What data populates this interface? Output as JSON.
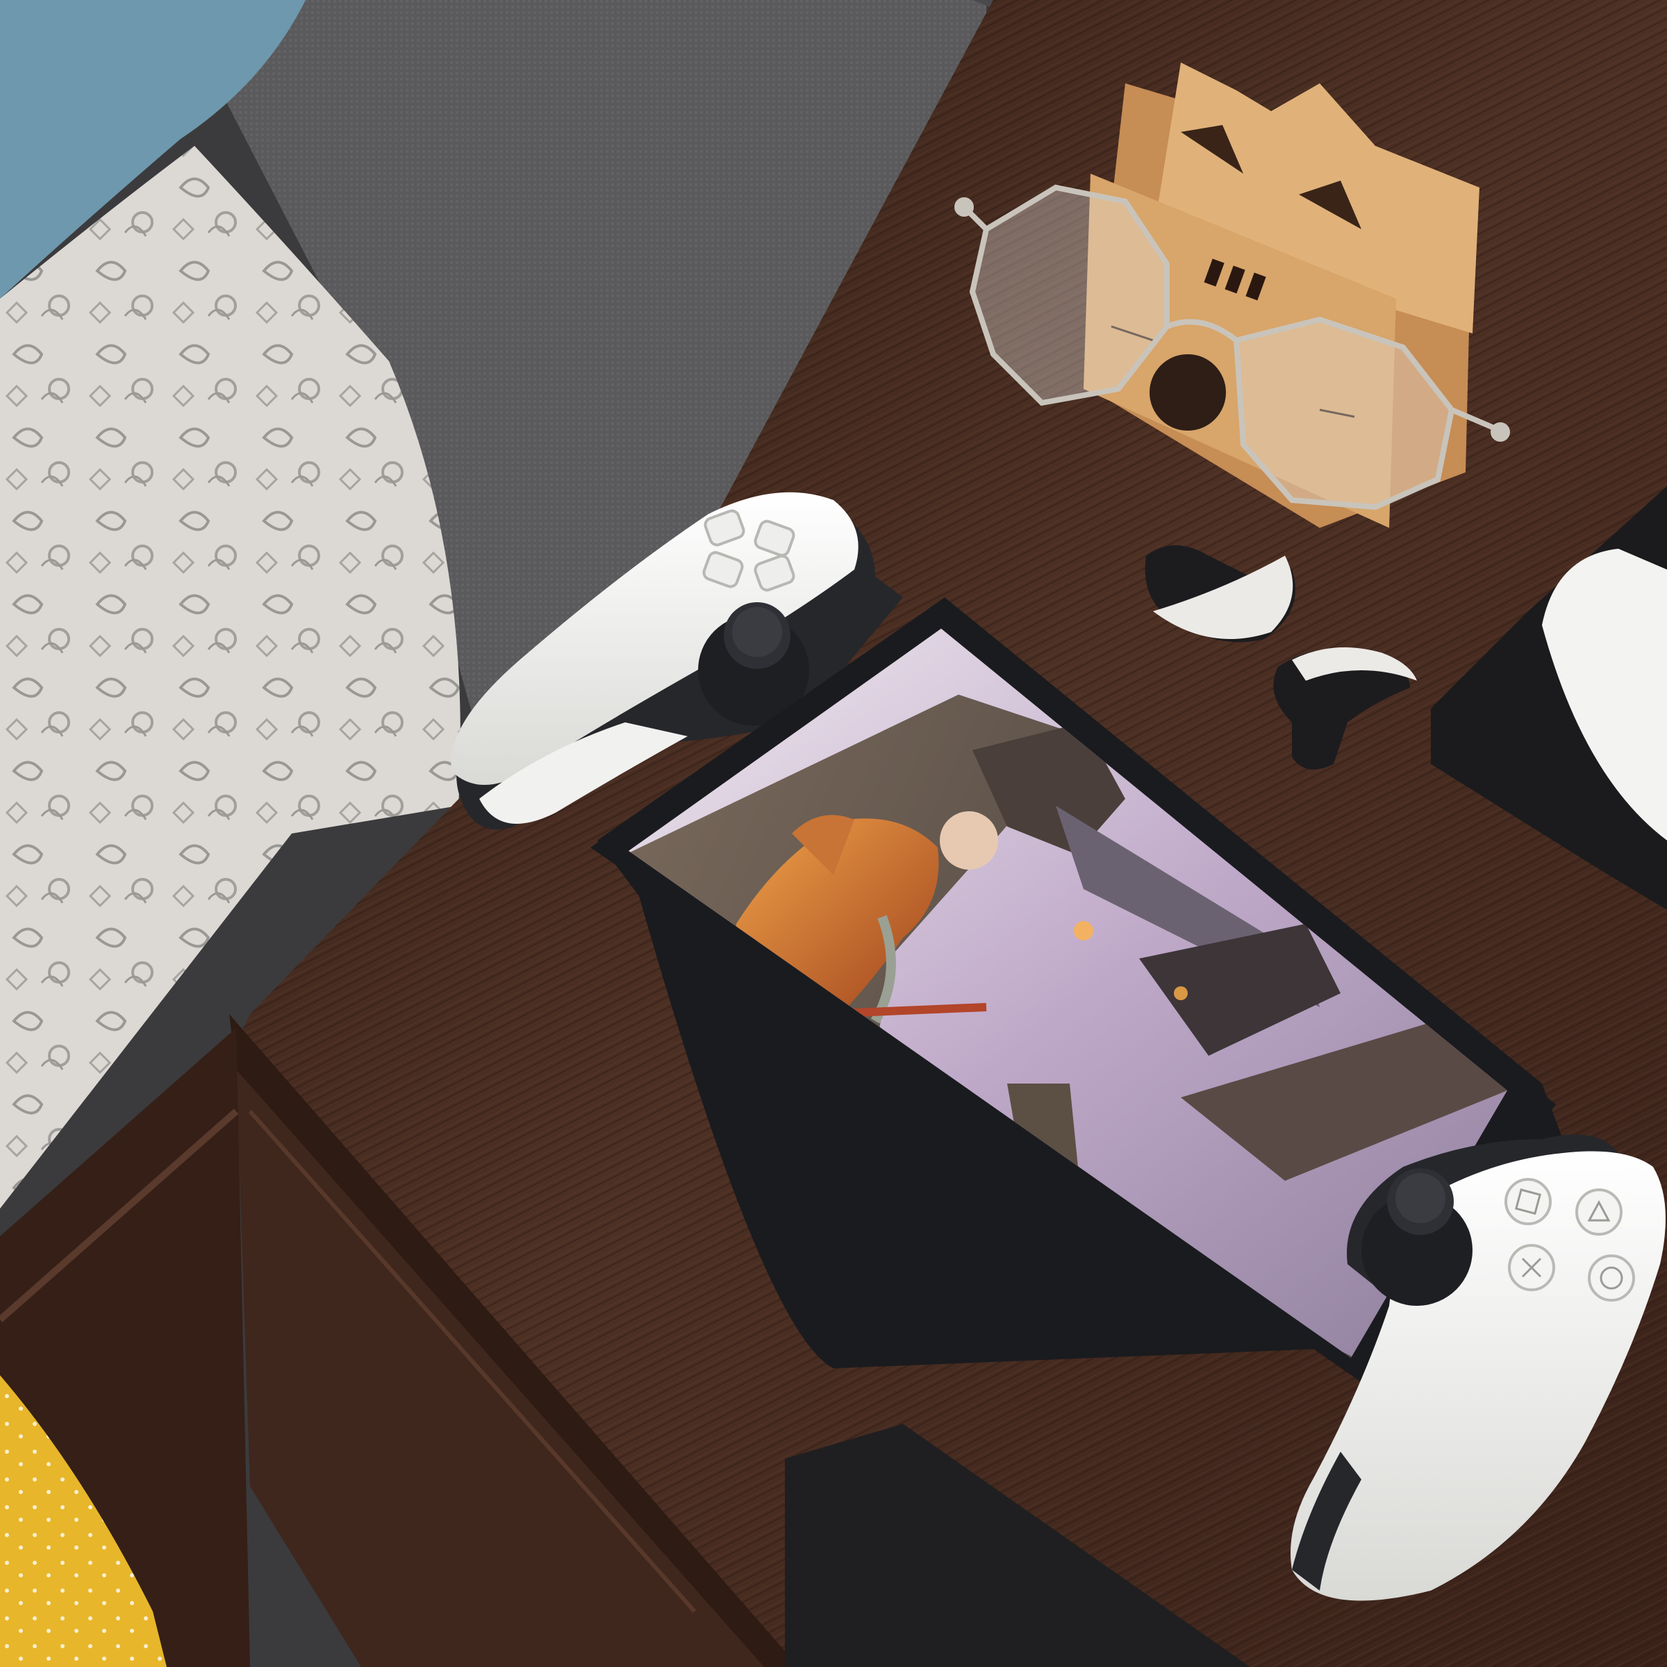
{
  "scene": {
    "description_free": true,
    "objects": [
      "bed-with-paisley-sheet",
      "grey-upholstered-headboard",
      "blue-pillow",
      "wooden-nightstand",
      "drawer",
      "playstation-portal-handheld",
      "game-screen",
      "left-controller-grip",
      "right-controller-grip",
      "wireless-earbuds",
      "eyeglasses",
      "wooden-cat-stand",
      "white-earbud-case",
      "yellow-cushion"
    ]
  },
  "controls": {
    "left": {
      "dpad": [
        "up-arrow-icon",
        "right-arrow-icon",
        "down-arrow-icon",
        "left-arrow-icon"
      ]
    },
    "right": {
      "face_buttons": [
        "square-icon",
        "triangle-icon",
        "cross-icon",
        "circle-icon"
      ]
    }
  },
  "colors": {
    "wood": "#4a2e22",
    "wood_dark": "#2e1b13",
    "headboard": "#5b5b5d",
    "sheet": "#d9d6d2",
    "pillow": "#6e98ad",
    "device_black": "#1a1b1f",
    "controller_white": "#f2f2f0",
    "cat_stand": "#d8a56a",
    "yellow": "#e7b62a"
  }
}
